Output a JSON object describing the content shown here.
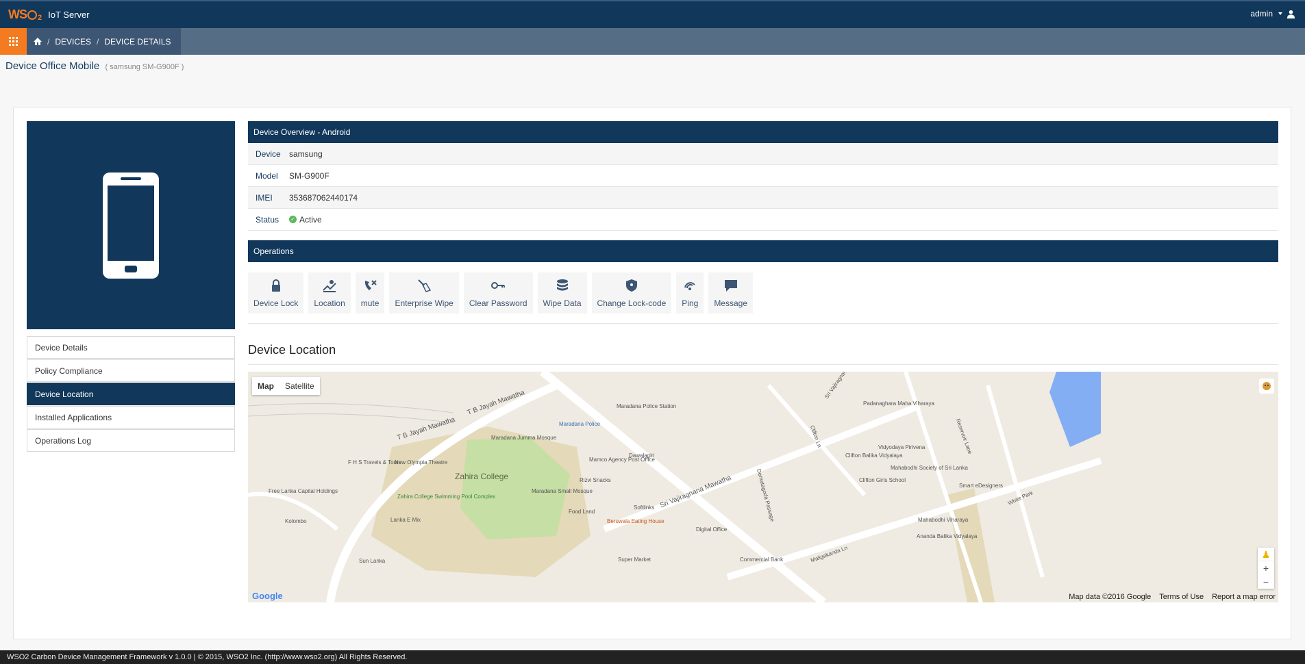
{
  "header": {
    "logo": "WSO2",
    "app_title": "IoT Server",
    "user": "admin"
  },
  "breadcrumb": {
    "items": [
      "DEVICES",
      "DEVICE DETAILS"
    ]
  },
  "page": {
    "title": "Device Office Mobile",
    "subtitle": "( samsung SM-G900F )"
  },
  "sidebar": {
    "items": [
      {
        "label": "Device Details"
      },
      {
        "label": "Policy Compliance"
      },
      {
        "label": "Device Location"
      },
      {
        "label": "Installed Applications"
      },
      {
        "label": "Operations Log"
      }
    ],
    "active": "Device Location"
  },
  "overview": {
    "heading": "Device Overview - Android",
    "rows": [
      {
        "key": "Device",
        "value": "samsung"
      },
      {
        "key": "Model",
        "value": "SM-G900F"
      },
      {
        "key": "IMEI",
        "value": "353687062440174"
      },
      {
        "key": "Status",
        "value": "Active"
      }
    ]
  },
  "operations": {
    "heading": "Operations",
    "items": [
      {
        "label": "Device Lock",
        "icon": "lock-icon"
      },
      {
        "label": "Location",
        "icon": "location-icon"
      },
      {
        "label": "mute",
        "icon": "mute-icon"
      },
      {
        "label": "Enterprise Wipe",
        "icon": "broom-icon"
      },
      {
        "label": "Clear Password",
        "icon": "key-icon"
      },
      {
        "label": "Wipe Data",
        "icon": "database-icon"
      },
      {
        "label": "Change Lock-code",
        "icon": "shield-icon"
      },
      {
        "label": "Ping",
        "icon": "ping-icon"
      },
      {
        "label": "Message",
        "icon": "message-icon"
      }
    ]
  },
  "location": {
    "heading": "Device Location",
    "map_tabs": [
      "Map",
      "Satellite"
    ],
    "labels": {
      "zahira": "Zahira College",
      "tb1": "T B Jayah Mawatha",
      "tb2": "T B Jayah Mawatha",
      "vaj": "Sri Vajiragnana Mawatha",
      "police": "Maradana Police Station",
      "police2": "Maradana Police",
      "mosque": "Maradana Jumma Mosque",
      "small_mosque": "Maradana Small Mosque",
      "fhs": "F H S Travels & Tours",
      "olympia": "New Olympia Theatre",
      "freelanka": "Free Lanka Capital Holdings",
      "kolombo": "Kolombo",
      "pool": "Zahira College Swimming Pool Complex",
      "lankaemix": "Lanka E Mix",
      "rizvi": "Rizvi Snacks",
      "foodland": "Food Land",
      "beruwala": "Beruwala Eating House",
      "softlinks": "Softlinks",
      "digital": "Digital Office",
      "commercial": "Commercial Bank",
      "padana": "Padanaghara Maha Viharaya",
      "vidyodaya": "Vidyodaya Pirivena",
      "clifton_balika": "Clifton Balika Vidyalaya",
      "clifton_girls": "Clifton Girls School",
      "mahabodhi_soc": "Mahabodhi Society of Sri Lanka",
      "smart": "Smart eDesigners",
      "mahabodhi_v": "Mahabodhi Viharaya",
      "ananda": "Ananda Balika Vidyalaya",
      "dawalagiri": "Dawalagiri",
      "mamco": "Mamco Agency Post Office",
      "superm": "Super Market",
      "sunlanka": "Sun Lanka",
      "clifton_ln": "Clifton Ln",
      "reservoir": "Reservoir Lane",
      "whitepark": "White Park",
      "maligakanda": "Maligakanda Ln",
      "demata": "Dematagoda Passage",
      "sri_vaj": "Sri Vajiragnana"
    },
    "footer": {
      "data": "Map data ©2016 Google",
      "terms": "Terms of Use",
      "report": "Report a map error",
      "google": "Google"
    }
  },
  "footer": {
    "text": "WSO2 Carbon Device Management Framework v 1.0.0 | © 2015, WSO2 Inc. (http://www.wso2.org) All Rights Reserved."
  }
}
